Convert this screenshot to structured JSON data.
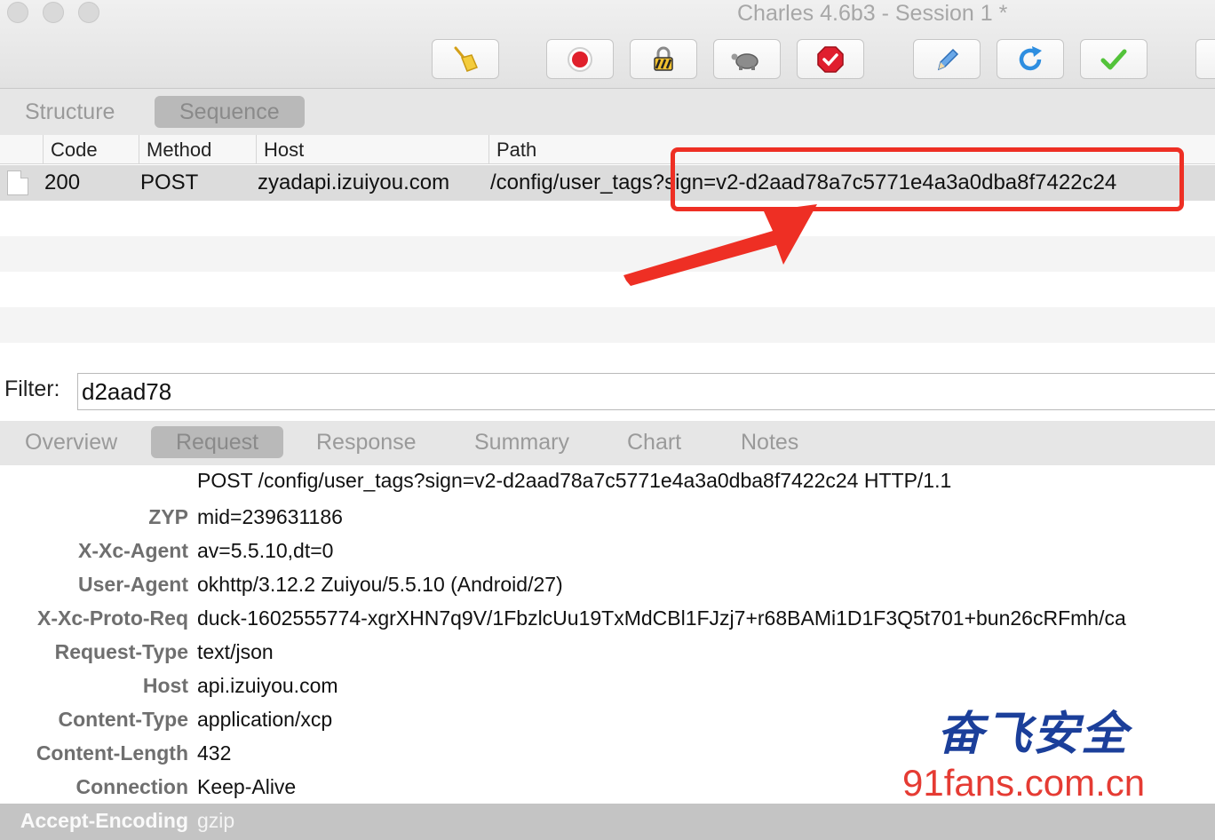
{
  "window": {
    "title": "Charles 4.6b3 - Session 1 *"
  },
  "toolbar": {
    "buttons": [
      {
        "name": "broom-icon"
      },
      {
        "name": "record-icon"
      },
      {
        "name": "ssl-lock-icon"
      },
      {
        "name": "throttle-turtle-icon"
      },
      {
        "name": "breakpoint-icon"
      },
      {
        "name": "pen-icon"
      },
      {
        "name": "refresh-icon"
      },
      {
        "name": "check-icon"
      }
    ]
  },
  "view_tabs": {
    "structure": "Structure",
    "sequence": "Sequence",
    "active": "Sequence"
  },
  "table": {
    "columns": [
      "Code",
      "Method",
      "Host",
      "Path"
    ],
    "rows": [
      {
        "code": "200",
        "method": "POST",
        "host": "zyadapi.izuiyou.com",
        "path": "/config/user_tags?sign=v2-d2aad78a7c5771e4a3a0dba8f7422c24"
      }
    ]
  },
  "filter": {
    "label": "Filter:",
    "value": "d2aad78"
  },
  "detail_tabs": {
    "items": [
      "Overview",
      "Request",
      "Response",
      "Summary",
      "Chart",
      "Notes"
    ],
    "active": "Request"
  },
  "request": {
    "request_line": "POST /config/user_tags?sign=v2-d2aad78a7c5771e4a3a0dba8f7422c24 HTTP/1.1",
    "headers": [
      {
        "name": "ZYP",
        "value": "mid=239631186"
      },
      {
        "name": "X-Xc-Agent",
        "value": "av=5.5.10,dt=0"
      },
      {
        "name": "User-Agent",
        "value": "okhttp/3.12.2 Zuiyou/5.5.10 (Android/27)"
      },
      {
        "name": "X-Xc-Proto-Req",
        "value": "duck-1602555774-xgrXHN7q9V/1FbzlcUu19TxMdCBl1FJzj7+r68BAMi1D1F3Q5t701+bun26cRFmh/ca"
      },
      {
        "name": "Request-Type",
        "value": "text/json"
      },
      {
        "name": "Host",
        "value": "api.izuiyou.com"
      },
      {
        "name": "Content-Type",
        "value": "application/xcp"
      },
      {
        "name": "Content-Length",
        "value": "432"
      },
      {
        "name": "Connection",
        "value": "Keep-Alive"
      },
      {
        "name": "Accept-Encoding",
        "value": "gzip"
      }
    ]
  },
  "watermark": {
    "chinese": "奋飞安全",
    "url": "91fans.com.cn"
  },
  "colors": {
    "annotation_red": "#ee2f24",
    "watermark_blue": "#1b3f9a",
    "watermark_red": "#e53b33"
  }
}
